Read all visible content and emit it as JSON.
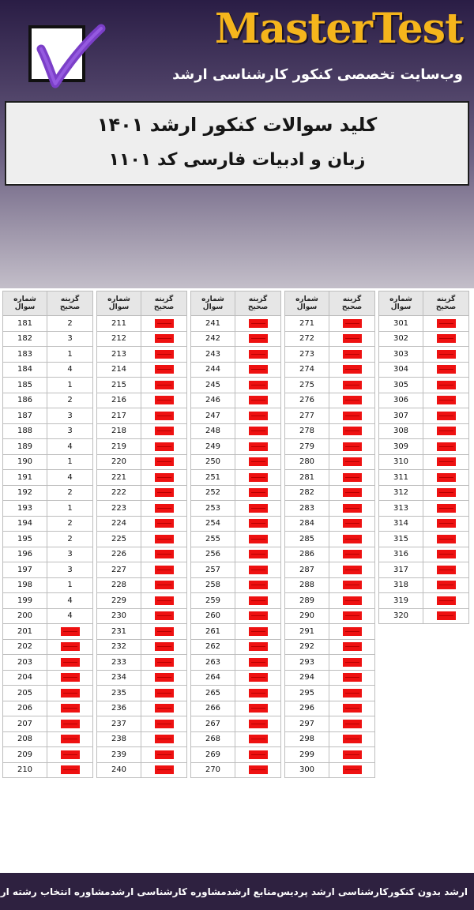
{
  "header": {
    "brand": "MasterTest",
    "tagline": "وب‌سایت تخصصی کنکور کارشناسی ارشد",
    "title_line1": "کلید سوالات کنکور ارشد ۱۴۰۱",
    "title_line2": "زبان و ادبیات فارسی کد ۱۱۰۱",
    "logo_icon": "checkmark-icon",
    "brand_color": "#f5b51c"
  },
  "table": {
    "col_answer_line1": "گزینه",
    "col_answer_line2": "صحیح",
    "col_question_line1": "شماره",
    "col_question_line2": "سوال",
    "hidden_marker_color": "#ee1111",
    "columns": [
      {
        "rows": [
          {
            "q": "181",
            "a": "2"
          },
          {
            "q": "182",
            "a": "3"
          },
          {
            "q": "183",
            "a": "1"
          },
          {
            "q": "184",
            "a": "4"
          },
          {
            "q": "185",
            "a": "1"
          },
          {
            "q": "186",
            "a": "2"
          },
          {
            "q": "187",
            "a": "3"
          },
          {
            "q": "188",
            "a": "3"
          },
          {
            "q": "189",
            "a": "4"
          },
          {
            "q": "190",
            "a": "1"
          },
          {
            "q": "191",
            "a": "4"
          },
          {
            "q": "192",
            "a": "2"
          },
          {
            "q": "193",
            "a": "1"
          },
          {
            "q": "194",
            "a": "2"
          },
          {
            "q": "195",
            "a": "2"
          },
          {
            "q": "196",
            "a": "3"
          },
          {
            "q": "197",
            "a": "3"
          },
          {
            "q": "198",
            "a": "1"
          },
          {
            "q": "199",
            "a": "4"
          },
          {
            "q": "200",
            "a": "4"
          },
          {
            "q": "201",
            "a": ""
          },
          {
            "q": "202",
            "a": ""
          },
          {
            "q": "203",
            "a": ""
          },
          {
            "q": "204",
            "a": ""
          },
          {
            "q": "205",
            "a": ""
          },
          {
            "q": "206",
            "a": ""
          },
          {
            "q": "207",
            "a": ""
          },
          {
            "q": "208",
            "a": ""
          },
          {
            "q": "209",
            "a": ""
          },
          {
            "q": "210",
            "a": ""
          }
        ]
      },
      {
        "rows": [
          {
            "q": "211",
            "a": ""
          },
          {
            "q": "212",
            "a": ""
          },
          {
            "q": "213",
            "a": ""
          },
          {
            "q": "214",
            "a": ""
          },
          {
            "q": "215",
            "a": ""
          },
          {
            "q": "216",
            "a": ""
          },
          {
            "q": "217",
            "a": ""
          },
          {
            "q": "218",
            "a": ""
          },
          {
            "q": "219",
            "a": ""
          },
          {
            "q": "220",
            "a": ""
          },
          {
            "q": "221",
            "a": ""
          },
          {
            "q": "222",
            "a": ""
          },
          {
            "q": "223",
            "a": ""
          },
          {
            "q": "224",
            "a": ""
          },
          {
            "q": "225",
            "a": ""
          },
          {
            "q": "226",
            "a": ""
          },
          {
            "q": "227",
            "a": ""
          },
          {
            "q": "228",
            "a": ""
          },
          {
            "q": "229",
            "a": ""
          },
          {
            "q": "230",
            "a": ""
          },
          {
            "q": "231",
            "a": ""
          },
          {
            "q": "232",
            "a": ""
          },
          {
            "q": "233",
            "a": ""
          },
          {
            "q": "234",
            "a": ""
          },
          {
            "q": "235",
            "a": ""
          },
          {
            "q": "236",
            "a": ""
          },
          {
            "q": "237",
            "a": ""
          },
          {
            "q": "238",
            "a": ""
          },
          {
            "q": "239",
            "a": ""
          },
          {
            "q": "240",
            "a": ""
          }
        ]
      },
      {
        "rows": [
          {
            "q": "241",
            "a": ""
          },
          {
            "q": "242",
            "a": ""
          },
          {
            "q": "243",
            "a": ""
          },
          {
            "q": "244",
            "a": ""
          },
          {
            "q": "245",
            "a": ""
          },
          {
            "q": "246",
            "a": ""
          },
          {
            "q": "247",
            "a": ""
          },
          {
            "q": "248",
            "a": ""
          },
          {
            "q": "249",
            "a": ""
          },
          {
            "q": "250",
            "a": ""
          },
          {
            "q": "251",
            "a": ""
          },
          {
            "q": "252",
            "a": ""
          },
          {
            "q": "253",
            "a": ""
          },
          {
            "q": "254",
            "a": ""
          },
          {
            "q": "255",
            "a": ""
          },
          {
            "q": "256",
            "a": ""
          },
          {
            "q": "257",
            "a": ""
          },
          {
            "q": "258",
            "a": ""
          },
          {
            "q": "259",
            "a": ""
          },
          {
            "q": "260",
            "a": ""
          },
          {
            "q": "261",
            "a": ""
          },
          {
            "q": "262",
            "a": ""
          },
          {
            "q": "263",
            "a": ""
          },
          {
            "q": "264",
            "a": ""
          },
          {
            "q": "265",
            "a": ""
          },
          {
            "q": "266",
            "a": ""
          },
          {
            "q": "267",
            "a": ""
          },
          {
            "q": "268",
            "a": ""
          },
          {
            "q": "269",
            "a": ""
          },
          {
            "q": "270",
            "a": ""
          }
        ]
      },
      {
        "rows": [
          {
            "q": "271",
            "a": ""
          },
          {
            "q": "272",
            "a": ""
          },
          {
            "q": "273",
            "a": ""
          },
          {
            "q": "274",
            "a": ""
          },
          {
            "q": "275",
            "a": ""
          },
          {
            "q": "276",
            "a": ""
          },
          {
            "q": "277",
            "a": ""
          },
          {
            "q": "278",
            "a": ""
          },
          {
            "q": "279",
            "a": ""
          },
          {
            "q": "280",
            "a": ""
          },
          {
            "q": "281",
            "a": ""
          },
          {
            "q": "282",
            "a": ""
          },
          {
            "q": "283",
            "a": ""
          },
          {
            "q": "284",
            "a": ""
          },
          {
            "q": "285",
            "a": ""
          },
          {
            "q": "286",
            "a": ""
          },
          {
            "q": "287",
            "a": ""
          },
          {
            "q": "288",
            "a": ""
          },
          {
            "q": "289",
            "a": ""
          },
          {
            "q": "290",
            "a": ""
          },
          {
            "q": "291",
            "a": ""
          },
          {
            "q": "292",
            "a": ""
          },
          {
            "q": "293",
            "a": ""
          },
          {
            "q": "294",
            "a": ""
          },
          {
            "q": "295",
            "a": ""
          },
          {
            "q": "296",
            "a": ""
          },
          {
            "q": "297",
            "a": ""
          },
          {
            "q": "298",
            "a": ""
          },
          {
            "q": "299",
            "a": ""
          },
          {
            "q": "300",
            "a": ""
          }
        ]
      },
      {
        "rows": [
          {
            "q": "301",
            "a": ""
          },
          {
            "q": "302",
            "a": ""
          },
          {
            "q": "303",
            "a": ""
          },
          {
            "q": "304",
            "a": ""
          },
          {
            "q": "305",
            "a": ""
          },
          {
            "q": "306",
            "a": ""
          },
          {
            "q": "307",
            "a": ""
          },
          {
            "q": "308",
            "a": ""
          },
          {
            "q": "309",
            "a": ""
          },
          {
            "q": "310",
            "a": ""
          },
          {
            "q": "311",
            "a": ""
          },
          {
            "q": "312",
            "a": ""
          },
          {
            "q": "313",
            "a": ""
          },
          {
            "q": "314",
            "a": ""
          },
          {
            "q": "315",
            "a": ""
          },
          {
            "q": "316",
            "a": ""
          },
          {
            "q": "317",
            "a": ""
          },
          {
            "q": "318",
            "a": ""
          },
          {
            "q": "319",
            "a": ""
          },
          {
            "q": "320",
            "a": ""
          }
        ]
      }
    ]
  },
  "footer": {
    "links": [
      "ارشد بدون کنکور",
      "کارشناسی ارشد پردیس",
      "منابع ارشد",
      "مشاوره کارشناسی ارشد",
      "مشاوره انتخاب رشته ارشد"
    ]
  }
}
